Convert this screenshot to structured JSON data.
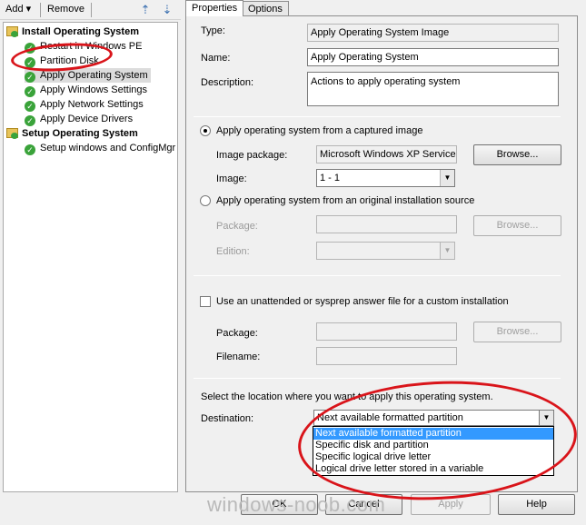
{
  "toolbar": {
    "add_label": "Add",
    "add_arrow": "▾",
    "remove_label": "Remove"
  },
  "tree": {
    "groups": [
      {
        "label": "Install Operating System",
        "items": [
          "Restart in Windows PE",
          "Partition Disk",
          "Apply Operating System",
          "Apply Windows Settings",
          "Apply Network Settings",
          "Apply Device Drivers"
        ]
      },
      {
        "label": "Setup Operating System",
        "items": [
          "Setup windows and ConfigMgr"
        ]
      }
    ],
    "selected_item": "Apply Operating System"
  },
  "tabs": [
    "Properties",
    "Options"
  ],
  "properties": {
    "type_label": "Type:",
    "type_value": "Apply Operating System Image",
    "name_label": "Name:",
    "name_value": "Apply Operating System",
    "description_label": "Description:",
    "description_value": "Actions to apply operating system",
    "radio_captured": "Apply operating system from a captured image",
    "image_package_label": "Image package:",
    "image_package_value": "Microsoft Windows XP Service P",
    "browse_label": "Browse...",
    "image_label": "Image:",
    "image_value": "1 - 1",
    "radio_original": "Apply operating system from an original installation source",
    "package_label": "Package:",
    "edition_label": "Edition:",
    "unattend_label": "Use an unattended or sysprep answer file for a custom installation",
    "filename_label": "Filename:",
    "location_prompt": "Select the location where you want to apply this operating system.",
    "destination_label": "Destination:",
    "destination_value": "Next available formatted partition",
    "destination_options": [
      "Next available formatted partition",
      "Specific disk and partition",
      "Specific logical drive letter",
      "Logical drive letter stored in a variable"
    ]
  },
  "buttons": {
    "ok": "OK",
    "cancel": "Cancel",
    "apply": "Apply",
    "help": "Help"
  },
  "watermark": "windows-noob.com",
  "colors": {
    "annotation": "#d9141a",
    "selection": "#3399ff",
    "check": "#3aa33a"
  }
}
